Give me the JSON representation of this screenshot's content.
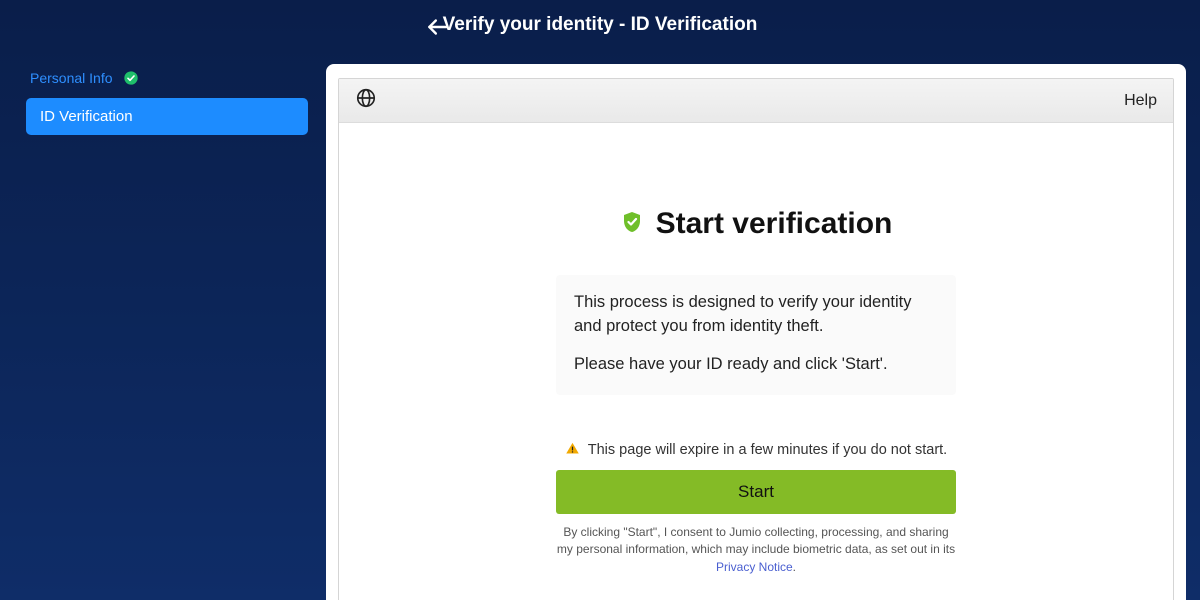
{
  "header": {
    "title": "Verify your identity - ID Verification"
  },
  "sidebar": {
    "steps": [
      {
        "label": "Personal Info",
        "state": "completed"
      },
      {
        "label": "ID Verification",
        "state": "active"
      }
    ]
  },
  "iframe": {
    "help_label": "Help"
  },
  "verify": {
    "title": "Start verification",
    "desc1": "This process is designed to verify your identity and protect you from identity theft.",
    "desc2": "Please have your ID ready and click 'Start'.",
    "expire_text": "This page will expire in a few minutes if you do not start.",
    "start_label": "Start",
    "consent_prefix": "By clicking \"Start\", I consent to Jumio collecting, processing, and sharing my personal information, which may include biometric data, as set out in its ",
    "privacy_label": "Privacy Notice",
    "consent_suffix": "."
  },
  "colors": {
    "accent_blue": "#1d8cff",
    "start_green": "#84bb26",
    "shield_green": "#6fbf2a"
  }
}
